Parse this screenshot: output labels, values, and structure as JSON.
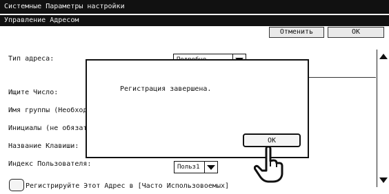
{
  "window": {
    "title": "Системные Параметры настройки"
  },
  "header": {
    "title": "Управление Адресом",
    "cancel_label": "Отменить",
    "ok_label": "OK"
  },
  "form": {
    "address_type_label": "Тип адреса:",
    "address_type_value": "Подробно",
    "search_number_label": "Ищите Число:",
    "group_name_label": "Имя группы (Необходи",
    "initials_label": "Инициалы (не обязате",
    "key_name_label": "Название Клавиши:",
    "user_index_label": "Индекс Пользователя:",
    "user_index_value": "Польз1",
    "register_checkbox_label": "Регистрируйте Этот Адрес в [Часто Использовоемых]"
  },
  "dialog": {
    "message": "Регистрация завершена.",
    "ok_label": "OK"
  },
  "icons": {
    "cursor": "pointing-hand-icon",
    "scroll_up": "scroll-up-icon",
    "scroll_down": "scroll-down-icon"
  }
}
